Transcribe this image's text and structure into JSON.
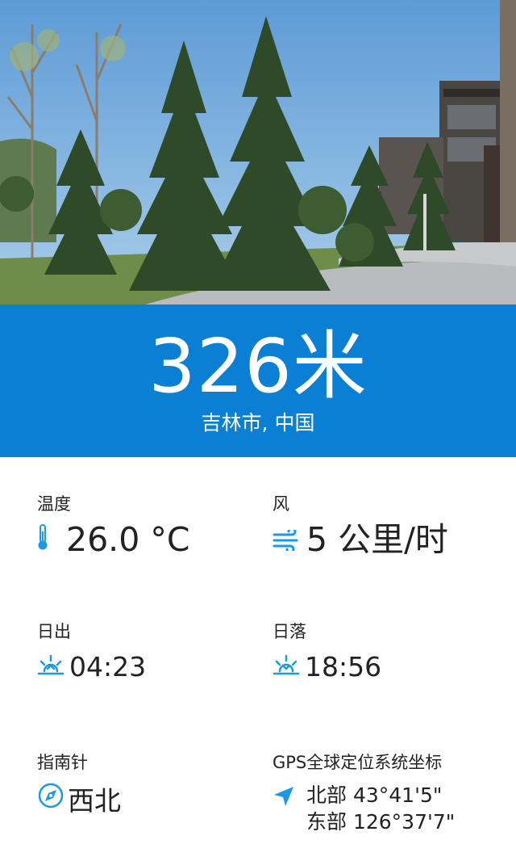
{
  "header": {
    "altitude": "326米",
    "location": "吉林市, 中国"
  },
  "temperature": {
    "label": "温度",
    "value": "26.0 °C",
    "icon": "thermometer-icon"
  },
  "wind": {
    "label": "风",
    "value": "5 公里/时",
    "icon": "wind-icon"
  },
  "sunrise": {
    "label": "日出",
    "value": "04:23",
    "icon": "sunrise-icon"
  },
  "sunset": {
    "label": "日落",
    "value": "18:56",
    "icon": "sunset-icon"
  },
  "compass": {
    "label": "指南针",
    "value": "西北",
    "icon": "compass-icon"
  },
  "gps": {
    "label": "GPS全球定位系统坐标",
    "lat": "北部 43°41'5\"",
    "lon": "东部 126°37'7\"",
    "icon": "location-arrow-icon"
  },
  "colors": {
    "banner": "#0a7fd3",
    "accent_icon": "#1a9ae6"
  }
}
